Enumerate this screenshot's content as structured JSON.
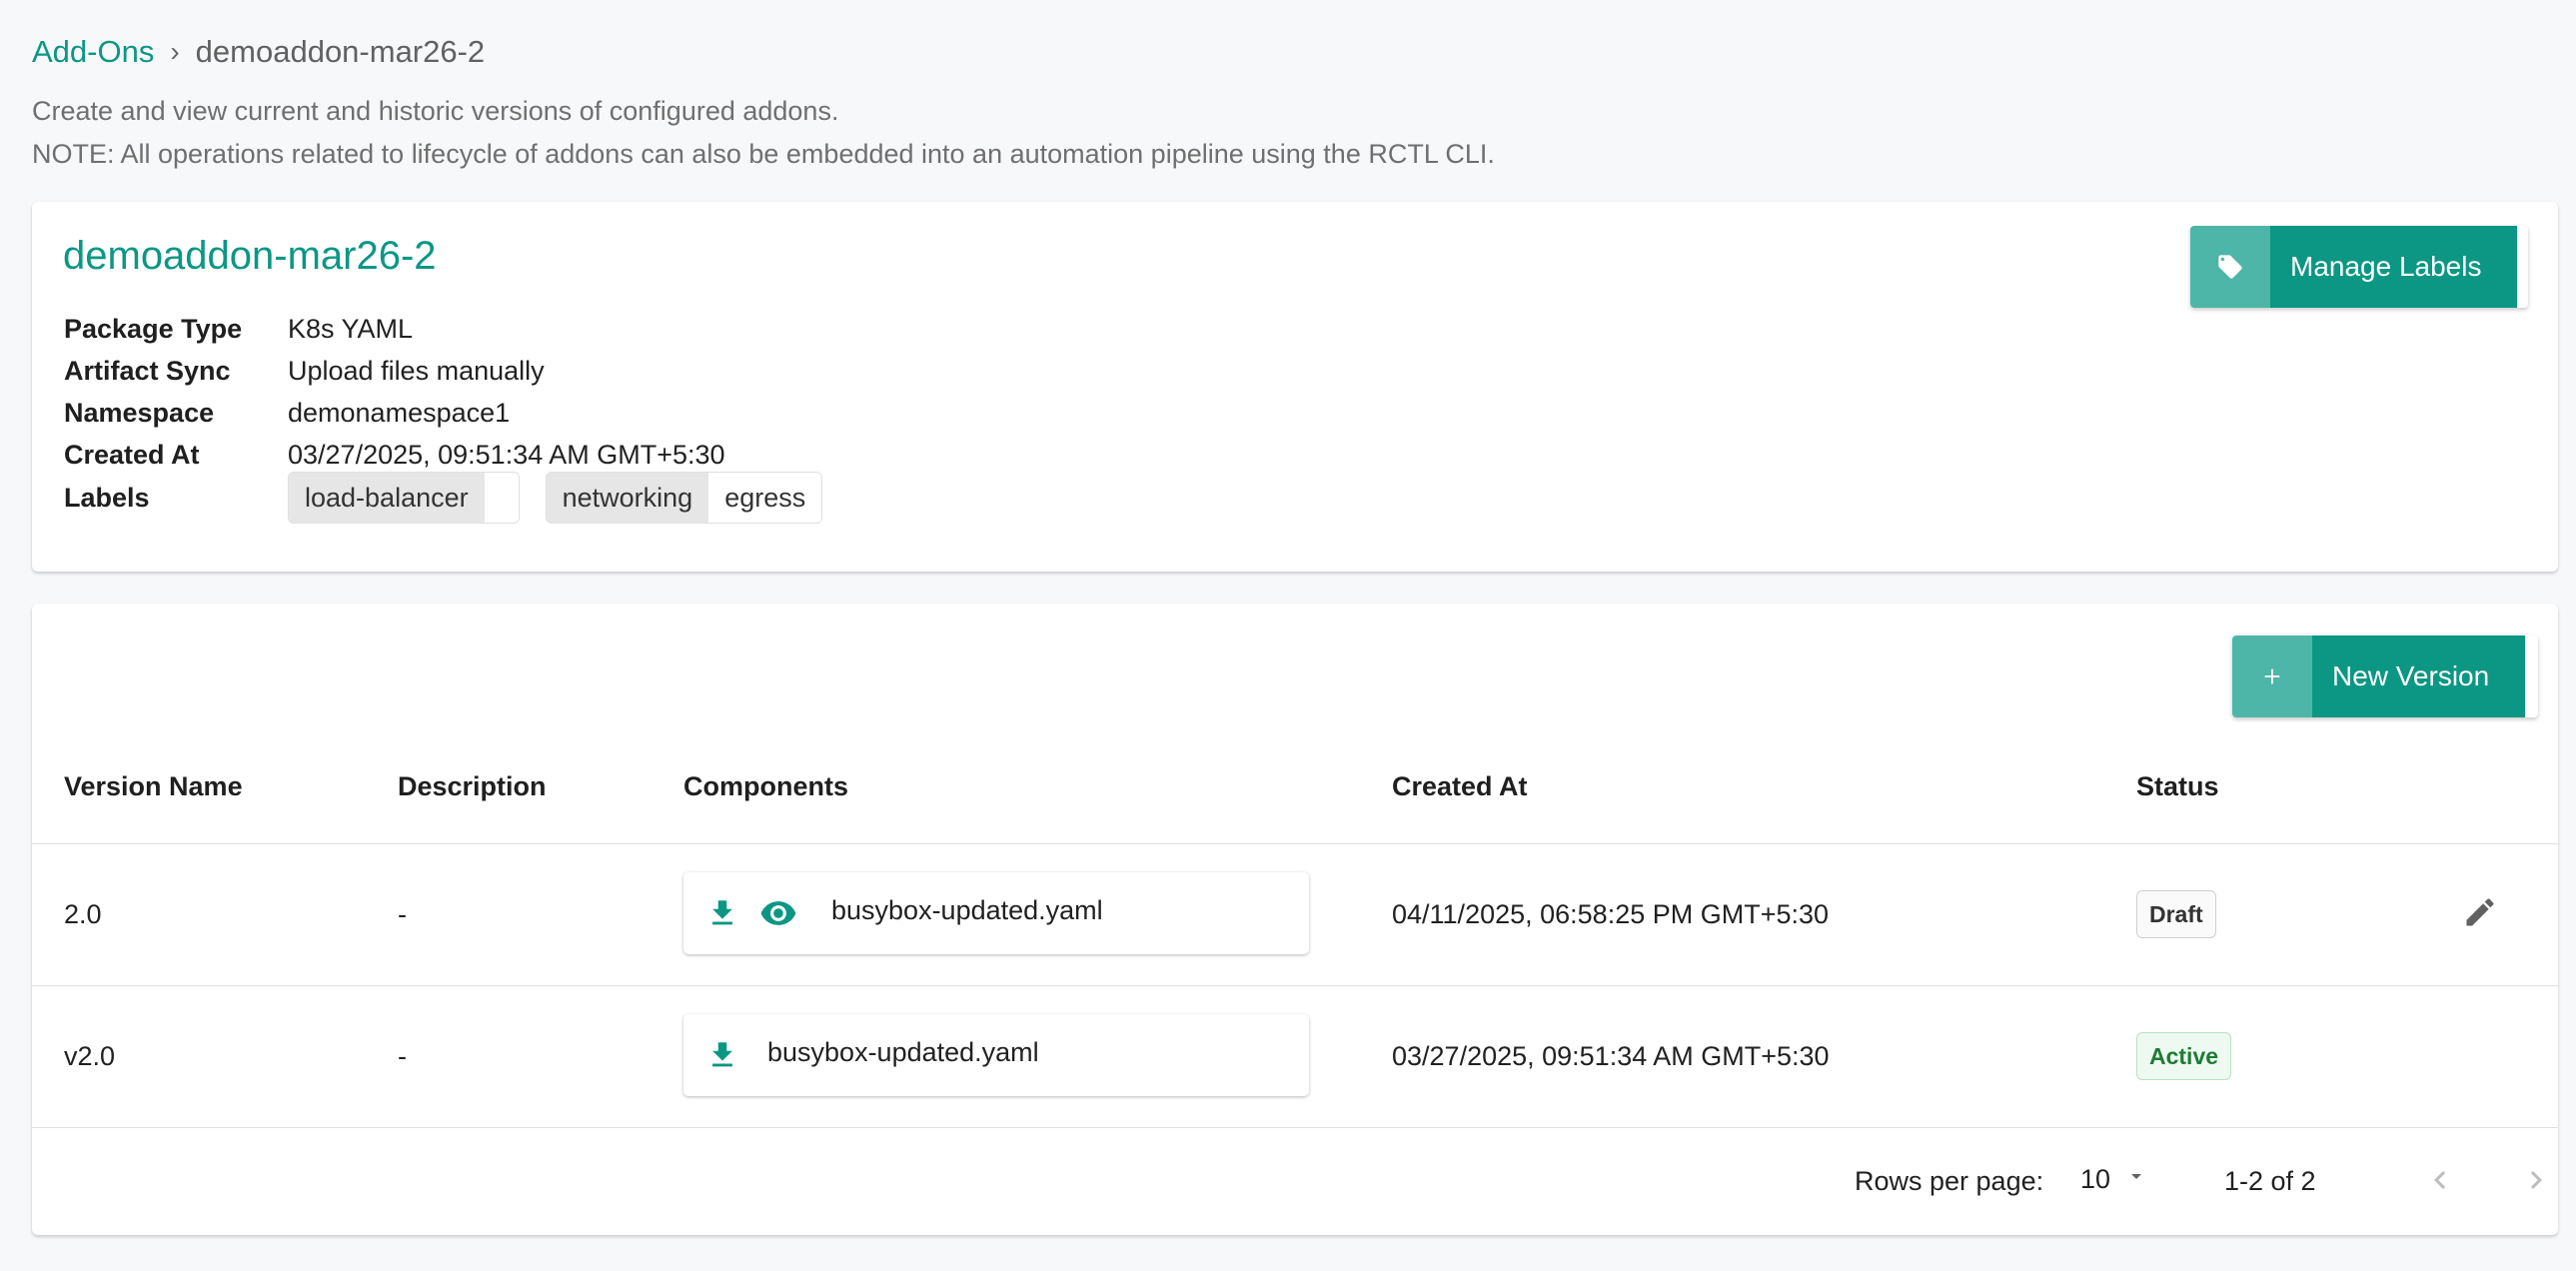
{
  "breadcrumb": {
    "parent": "Add-Ons",
    "separator": "›",
    "current": "demoaddon-mar26-2"
  },
  "subtitle": {
    "line1": "Create and view current and historic versions of configured addons.",
    "line2": "NOTE: All operations related to lifecycle of addons can also be embedded into an automation pipeline using the RCTL CLI."
  },
  "addon": {
    "name": "demoaddon-mar26-2",
    "manage_labels_button": "Manage Labels",
    "details": [
      {
        "label": "Package Type",
        "value": "K8s YAML"
      },
      {
        "label": "Artifact Sync",
        "value": "Upload files manually"
      },
      {
        "label": "Namespace",
        "value": "demonamespace1"
      },
      {
        "label": "Created At",
        "value": "03/27/2025, 09:51:34 AM GMT+5:30"
      }
    ],
    "labels_title": "Labels",
    "labels": [
      {
        "key": "load-balancer",
        "value": ""
      },
      {
        "key": "networking",
        "value": "egress"
      }
    ]
  },
  "versions": {
    "new_version_button": "New Version",
    "columns": [
      "Version Name",
      "Description",
      "Components",
      "Created At",
      "Status"
    ],
    "rows": [
      {
        "name": "2.0",
        "description": "-",
        "component": "busybox-updated.yaml",
        "created_at": "04/11/2025, 06:58:25 PM GMT+5:30",
        "status": "Draft"
      },
      {
        "name": "v2.0",
        "description": "-",
        "component": "busybox-updated.yaml",
        "created_at": "03/27/2025, 09:51:34 AM GMT+5:30",
        "status": "Active"
      }
    ],
    "pagination": {
      "rows_per_page_label": "Rows per page:",
      "rows_per_page": "10",
      "range": "1-2 of 2"
    }
  },
  "colors": {
    "accent": "#0b9784",
    "accent_light": "#4db6a8",
    "active_badge": "#1e7b34"
  },
  "icons": [
    "tag-icon",
    "plus-icon",
    "download-icon",
    "eye-icon",
    "pencil-icon",
    "chevron-left-icon",
    "chevron-right-icon",
    "caret-down-icon"
  ]
}
